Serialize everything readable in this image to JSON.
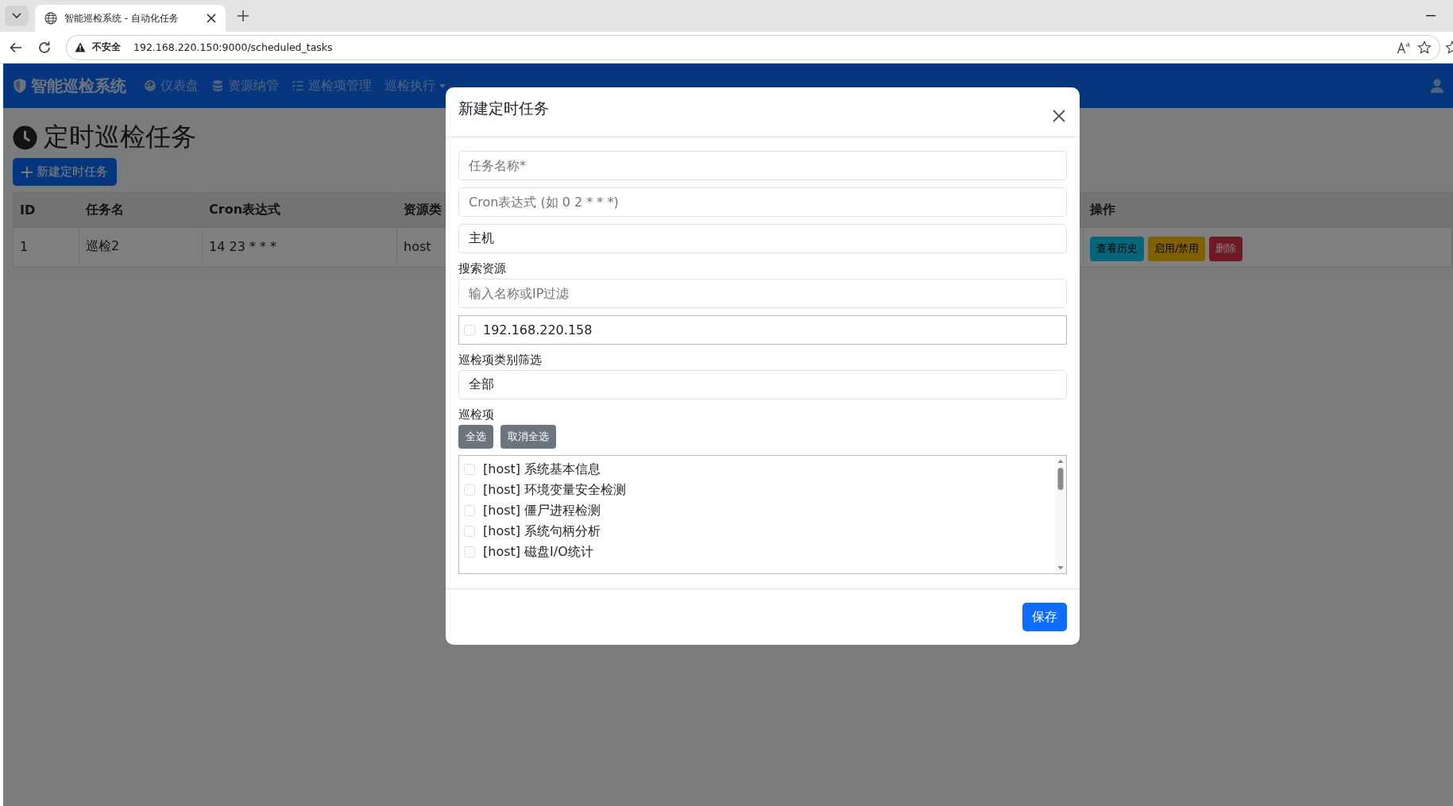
{
  "browser": {
    "tab_title": "智能巡检系统 - 自动化任务",
    "security_label": "不安全",
    "url": "192.168.220.150:9000/scheduled_tasks"
  },
  "navbar": {
    "brand": "智能巡检系统",
    "items": [
      {
        "label": "仪表盘",
        "dropdown": false
      },
      {
        "label": "资源纳管",
        "dropdown": false
      },
      {
        "label": "巡检项管理",
        "dropdown": false
      },
      {
        "label": "巡检执行",
        "dropdown": true
      }
    ]
  },
  "page": {
    "title": "定时巡检任务",
    "new_button": "新建定时任务"
  },
  "table": {
    "columns": [
      "ID",
      "任务名",
      "Cron表达式",
      "资源类",
      "操作"
    ],
    "rows": [
      {
        "cells": [
          "1",
          "巡检2",
          "14 23 * * *",
          "host"
        ],
        "actions": [
          {
            "label": "查看历史",
            "kind": "info"
          },
          {
            "label": "启用/禁用",
            "kind": "warning"
          },
          {
            "label": "删除",
            "kind": "danger"
          }
        ]
      }
    ]
  },
  "modal": {
    "title": "新建定时任务",
    "fields": [
      {
        "kind": "input",
        "placeholder": "任务名称*"
      },
      {
        "kind": "input",
        "placeholder": "Cron表达式 (如 0 2 * * *)"
      },
      {
        "kind": "select",
        "value": "主机"
      },
      {
        "kind": "label",
        "text": "搜索资源"
      },
      {
        "kind": "input",
        "placeholder": "输入名称或IP过滤"
      },
      {
        "kind": "checklist",
        "items": [
          {
            "label": "192.168.220.158",
            "checked": false
          }
        ]
      },
      {
        "kind": "label",
        "text": "巡检项类别筛选"
      },
      {
        "kind": "select",
        "value": "全部"
      },
      {
        "kind": "label",
        "text": "巡检项"
      },
      {
        "kind": "buttons",
        "buttons": [
          "全选",
          "取消全选"
        ]
      },
      {
        "kind": "scroll_list",
        "items": [
          {
            "label": "[host] 系统基本信息",
            "checked": false
          },
          {
            "label": "[host] 环境变量安全检测",
            "checked": false
          },
          {
            "label": "[host] 僵尸进程检测",
            "checked": false
          },
          {
            "label": "[host] 系统句柄分析",
            "checked": false
          },
          {
            "label": "[host] 磁盘I/O统计",
            "checked": false
          }
        ]
      }
    ],
    "save_button": "保存"
  }
}
